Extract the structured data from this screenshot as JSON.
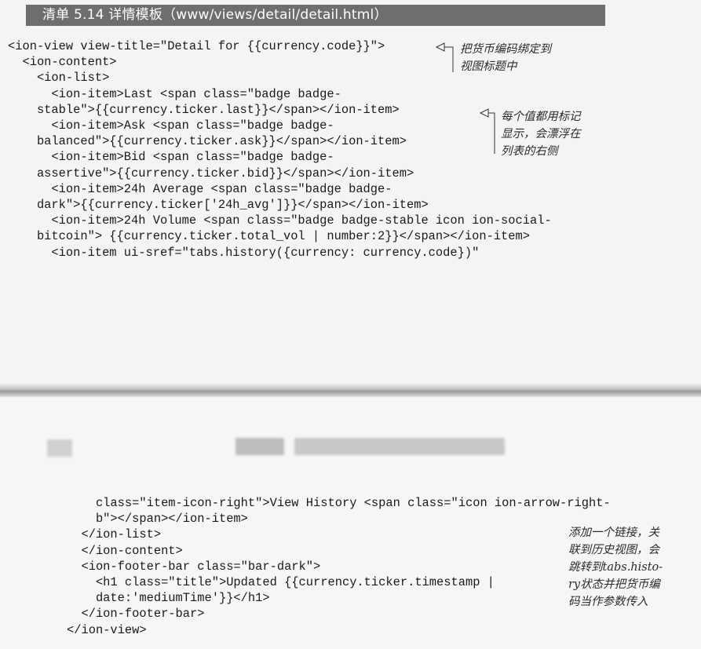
{
  "listing": {
    "title": "清单 5.14  详情模板（www/views/detail/detail.html）"
  },
  "code_top": [
    "<ion-view view-title=\"Detail for {{currency.code}}\">",
    "  <ion-content>",
    "    <ion-list>",
    "      <ion-item>Last <span class=\"badge badge-",
    "    stable\">{{currency.ticker.last}}</span></ion-item>",
    "      <ion-item>Ask <span class=\"badge badge-",
    "    balanced\">{{currency.ticker.ask}}</span></ion-item>",
    "      <ion-item>Bid <span class=\"badge badge-",
    "    assertive\">{{currency.ticker.bid}}</span></ion-item>",
    "      <ion-item>24h Average <span class=\"badge badge-",
    "    dark\">{{currency.ticker['24h_avg']}}</span></ion-item>",
    "      <ion-item>24h Volume <span class=\"badge badge-stable icon ion-social-",
    "    bitcoin\"> {{currency.ticker.total_vol | number:2}}</span></ion-item>",
    "      <ion-item ui-sref=\"tabs.history({currency: currency.code})\""
  ],
  "code_bottom": [
    "    class=\"item-icon-right\">View History <span class=\"icon ion-arrow-right-",
    "    b\"></span></ion-item>",
    "  </ion-list>",
    "  </ion-content>",
    "  <ion-footer-bar class=\"bar-dark\">",
    "    <h1 class=\"title\">Updated {{currency.ticker.timestamp |",
    "    date:'mediumTime'}}</h1>",
    "  </ion-footer-bar>",
    "</ion-view>"
  ],
  "annotations": {
    "a1": "把货币编码绑定到\n视图标题中",
    "a2": "每个值都用标记\n显示，会漂浮在\n列表的右侧",
    "a3": "添加一个链接，关\n联到历史视图，会\n跳转到tabs.histo-\nry状态并把货币编\n码当作参数传入"
  },
  "colors": {
    "header_bg": "#6e6e6e",
    "page_bg": "#f4f4f2"
  }
}
